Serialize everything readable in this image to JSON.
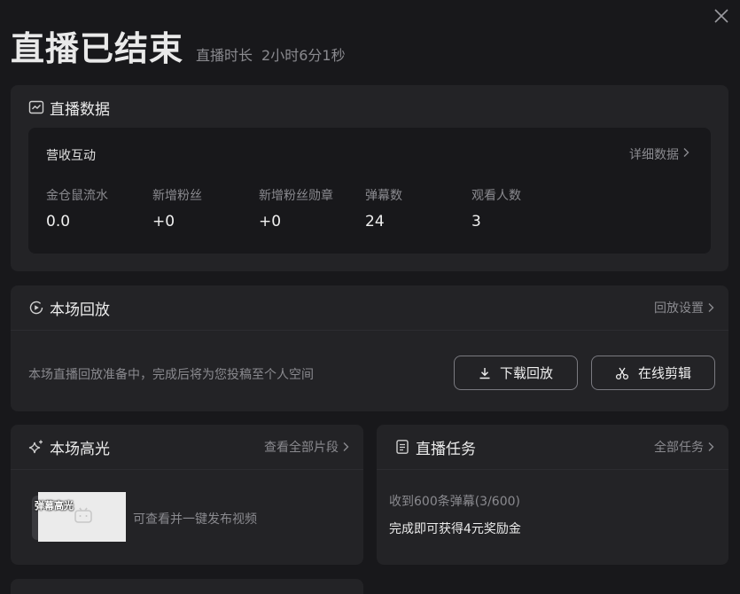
{
  "header": {
    "title": "直播已结束",
    "duration_label": "直播时长",
    "duration_value": "2小时6分1秒"
  },
  "live_data": {
    "title": "直播数据",
    "inner_title": "营收互动",
    "detail_link": "详细数据",
    "stats": [
      {
        "label": "金仓鼠流水",
        "value": "0.0"
      },
      {
        "label": "新增粉丝",
        "value": "+0"
      },
      {
        "label": "新增粉丝勋章",
        "value": "+0"
      },
      {
        "label": "弹幕数",
        "value": "24"
      },
      {
        "label": "观看人数",
        "value": "3"
      }
    ]
  },
  "replay": {
    "title": "本场回放",
    "settings_link": "回放设置",
    "status_text": "本场直播回放准备中，完成后将为您投稿至个人空间",
    "download_label": "下载回放",
    "edit_label": "在线剪辑"
  },
  "highlights": {
    "title": "本场高光",
    "view_all_link": "查看全部片段",
    "thumb_tag": "弹幕高光",
    "hint_text": "可查看并一键发布视频"
  },
  "tasks": {
    "title": "直播任务",
    "all_link": "全部任务",
    "progress_text": "收到600条弹幕(3/600)",
    "reward_text": "完成即可获得4元奖励金"
  },
  "icons": {
    "close": "close-icon",
    "chart": "chart-icon",
    "replay": "play-circle-icon",
    "sparkle": "sparkle-icon",
    "task": "document-icon",
    "download": "download-icon",
    "scissors": "scissors-icon",
    "chevron": "chevron-right-icon"
  },
  "colors": {
    "background": "#18181b",
    "panel": "#232326",
    "muted_text": "#8a8a8f"
  }
}
